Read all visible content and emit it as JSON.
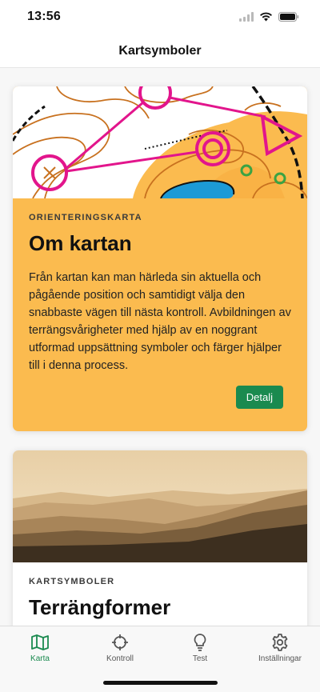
{
  "status_bar": {
    "time": "13:56",
    "icons": [
      "signal-icon",
      "wifi-icon",
      "battery-icon"
    ]
  },
  "nav": {
    "title": "Kartsymboler"
  },
  "cards": [
    {
      "eyebrow": "ORIENTERINGSKARTA",
      "title": "Om kartan",
      "text": "Från kartan kan man härleda sin aktuella och pågående position och samtidigt välja den snabbaste vägen till nästa kontroll. Avbildningen av terrängsvårigheter med hjälp av en noggrant utformad uppsättning symboler och färger hjälper till i denna process.",
      "button_label": "Detalj",
      "background": "#fbbb4f"
    },
    {
      "eyebrow": "KARTSYMBOLER",
      "title": "Terrängformer"
    }
  ],
  "tabs": [
    {
      "label": "Karta",
      "icon": "map-icon",
      "active": true
    },
    {
      "label": "Kontroll",
      "icon": "crosshair-icon",
      "active": false
    },
    {
      "label": "Test",
      "icon": "lightbulb-icon",
      "active": false
    },
    {
      "label": "Inställningar",
      "icon": "gear-icon",
      "active": false
    }
  ],
  "colors": {
    "accent": "#1a8a4f",
    "card_yellow": "#fbbb4f",
    "course_magenta": "#e2158c"
  }
}
